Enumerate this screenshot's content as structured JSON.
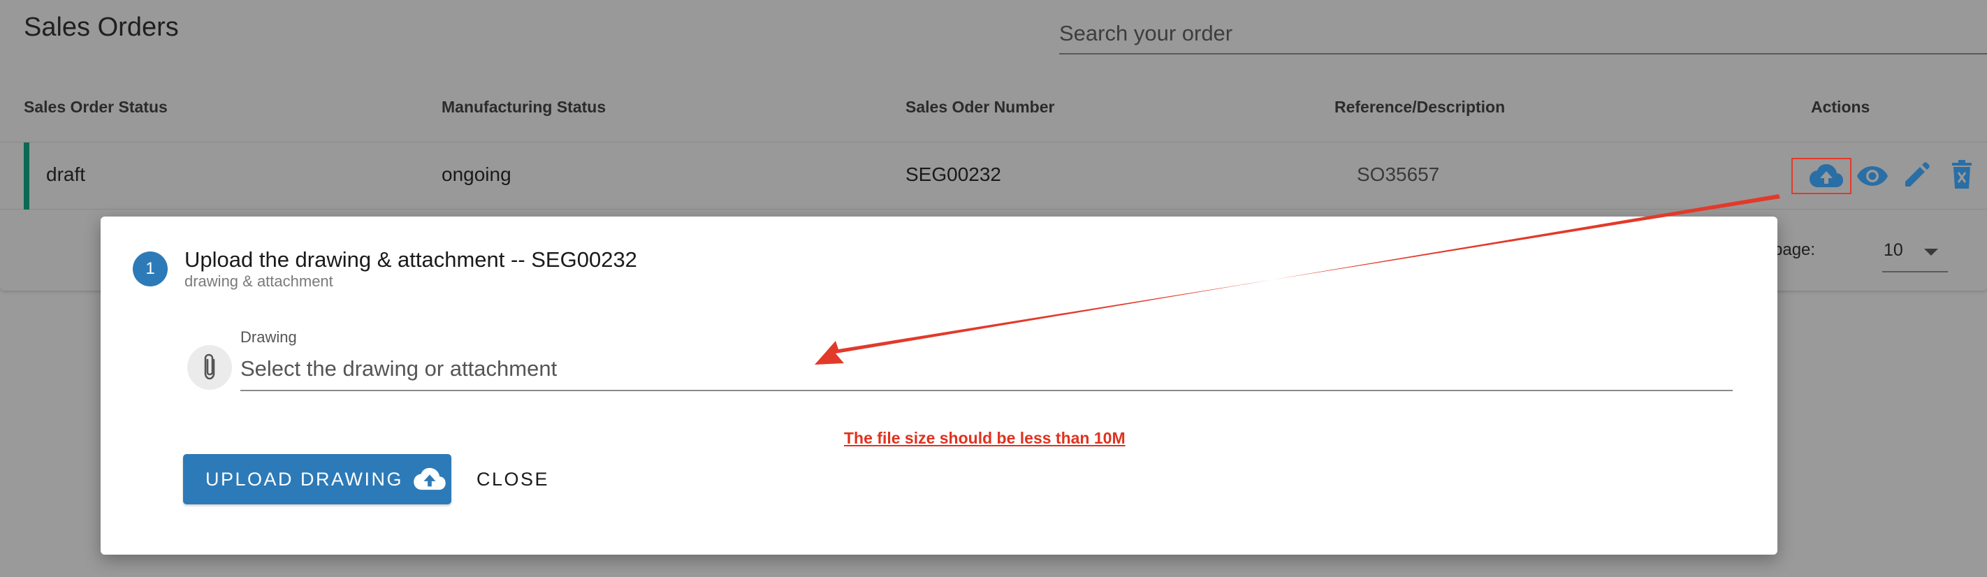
{
  "page": {
    "title": "Sales Orders",
    "search_placeholder": "Search your order"
  },
  "table": {
    "headers": [
      "Sales Order Status",
      "Manufacturing Status",
      "Sales Oder Number",
      "Reference/Description",
      "Actions"
    ],
    "rows": [
      {
        "sales_order_status": "draft",
        "manufacturing_status": "ongoing",
        "sales_order_number": "SEG00232",
        "reference": "SO35657"
      }
    ],
    "row_actions": [
      "cloud-upload-icon",
      "eye-icon",
      "pencil-icon",
      "trash-icon"
    ],
    "rows_per_page_label": "er page:",
    "rows_per_page_value": "10"
  },
  "dialog": {
    "step_number": "1",
    "title": "Upload the drawing & attachment -- SEG00232",
    "subtitle": "drawing & attachment",
    "field_label": "Drawing",
    "field_placeholder": "Select the drawing or attachment",
    "warning": "The file size should be less than 10M",
    "upload_label": "UPLOAD DRAWING",
    "close_label": "CLOSE"
  },
  "colors": {
    "primary": "#2d7ab8",
    "accent_row": "#0d6a52",
    "annotation": "#e23a2a"
  }
}
